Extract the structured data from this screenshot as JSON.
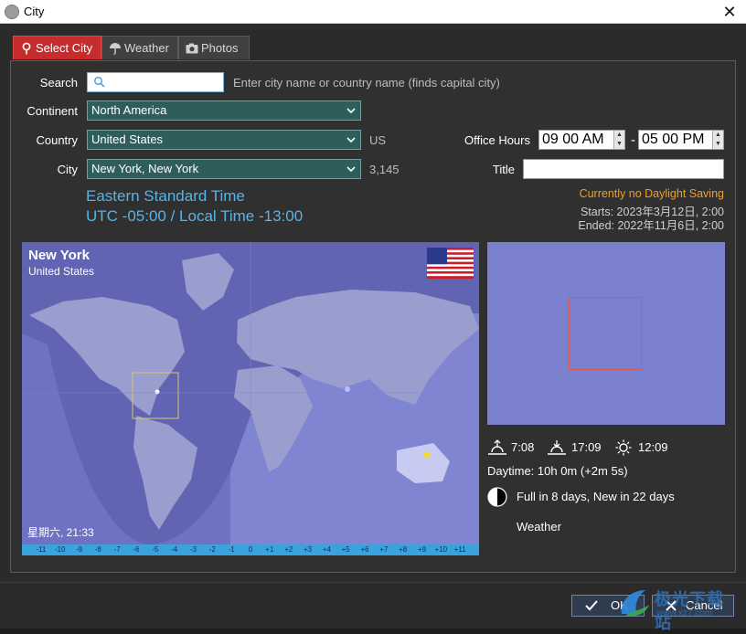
{
  "window": {
    "title": "City"
  },
  "tabs": [
    {
      "label": "Select City",
      "active": true,
      "icon": "pin-icon"
    },
    {
      "label": "Weather",
      "active": false,
      "icon": "umbrella-icon"
    },
    {
      "label": "Photos",
      "active": false,
      "icon": "camera-icon"
    }
  ],
  "form": {
    "search_label": "Search",
    "search_value": "",
    "search_hint": "Enter city name or country name (finds capital city)",
    "continent_label": "Continent",
    "continent_value": "North America",
    "country_label": "Country",
    "country_value": "United States",
    "country_code": "US",
    "city_label": "City",
    "city_value": "New York, New York",
    "city_population": "3,145",
    "office_hours_label": "Office Hours",
    "office_start": "09 00 AM",
    "office_separator": "-",
    "office_end": "05 00 PM",
    "title_label": "Title",
    "title_value": ""
  },
  "timezone": {
    "name": "Eastern Standard Time",
    "offset": "UTC -05:00 / Local Time -13:00"
  },
  "dst": {
    "status": "Currently no Daylight Saving",
    "starts": "Starts: 2023年3月12日, 2:00",
    "ended": "Ended: 2022年11月6日, 2:00"
  },
  "map": {
    "city": "New York",
    "country": "United States",
    "local_time": "星期六, 21:33",
    "timezone_ticks": [
      "-11",
      "-10",
      "-9",
      "-8",
      "-7",
      "-6",
      "-5",
      "-4",
      "-3",
      "-2",
      "-1",
      "0",
      "+1",
      "+2",
      "+3",
      "+4",
      "+5",
      "+6",
      "+7",
      "+8",
      "+9",
      "+10",
      "+11"
    ]
  },
  "sun": {
    "sunrise": "7:08",
    "sunset": "17:09",
    "noon": "12:09",
    "daytime": "Daytime: 10h 0m (+2m 5s)"
  },
  "moon": {
    "text": "Full in 8 days, New in 22 days"
  },
  "weather": {
    "label": "Weather"
  },
  "buttons": {
    "ok": "OK",
    "cancel": "Cancel"
  },
  "watermark": {
    "text": "极光下载站",
    "url": "www.xz7.com"
  },
  "colors": {
    "accent_tab": "#c62c2c",
    "timezone_text": "#56b4e8",
    "dst_status": "#f0a020",
    "map_water": "#6d72c2",
    "select_bg": "#2e5e5c"
  }
}
